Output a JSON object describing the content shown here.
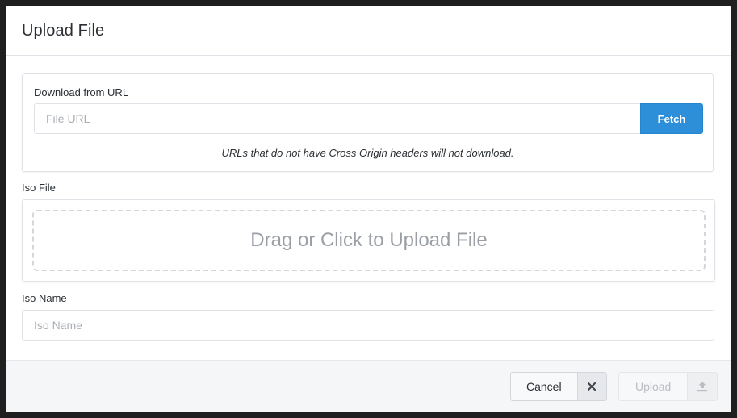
{
  "dialog": {
    "title": "Upload File"
  },
  "url_section": {
    "label": "Download from URL",
    "input_placeholder": "File URL",
    "input_value": "",
    "fetch_label": "Fetch",
    "help_text": "URLs that do not have Cross Origin headers will not download."
  },
  "iso_file": {
    "label": "Iso File",
    "dropzone_text": "Drag or Click to Upload File"
  },
  "iso_name": {
    "label": "Iso Name",
    "input_placeholder": "Iso Name",
    "input_value": ""
  },
  "footer": {
    "cancel_label": "Cancel",
    "cancel_icon": "close-icon",
    "upload_label": "Upload",
    "upload_icon": "upload-icon",
    "upload_disabled": true
  },
  "colors": {
    "accent": "#2d8fd9",
    "footer_bg": "#f5f6f8"
  }
}
